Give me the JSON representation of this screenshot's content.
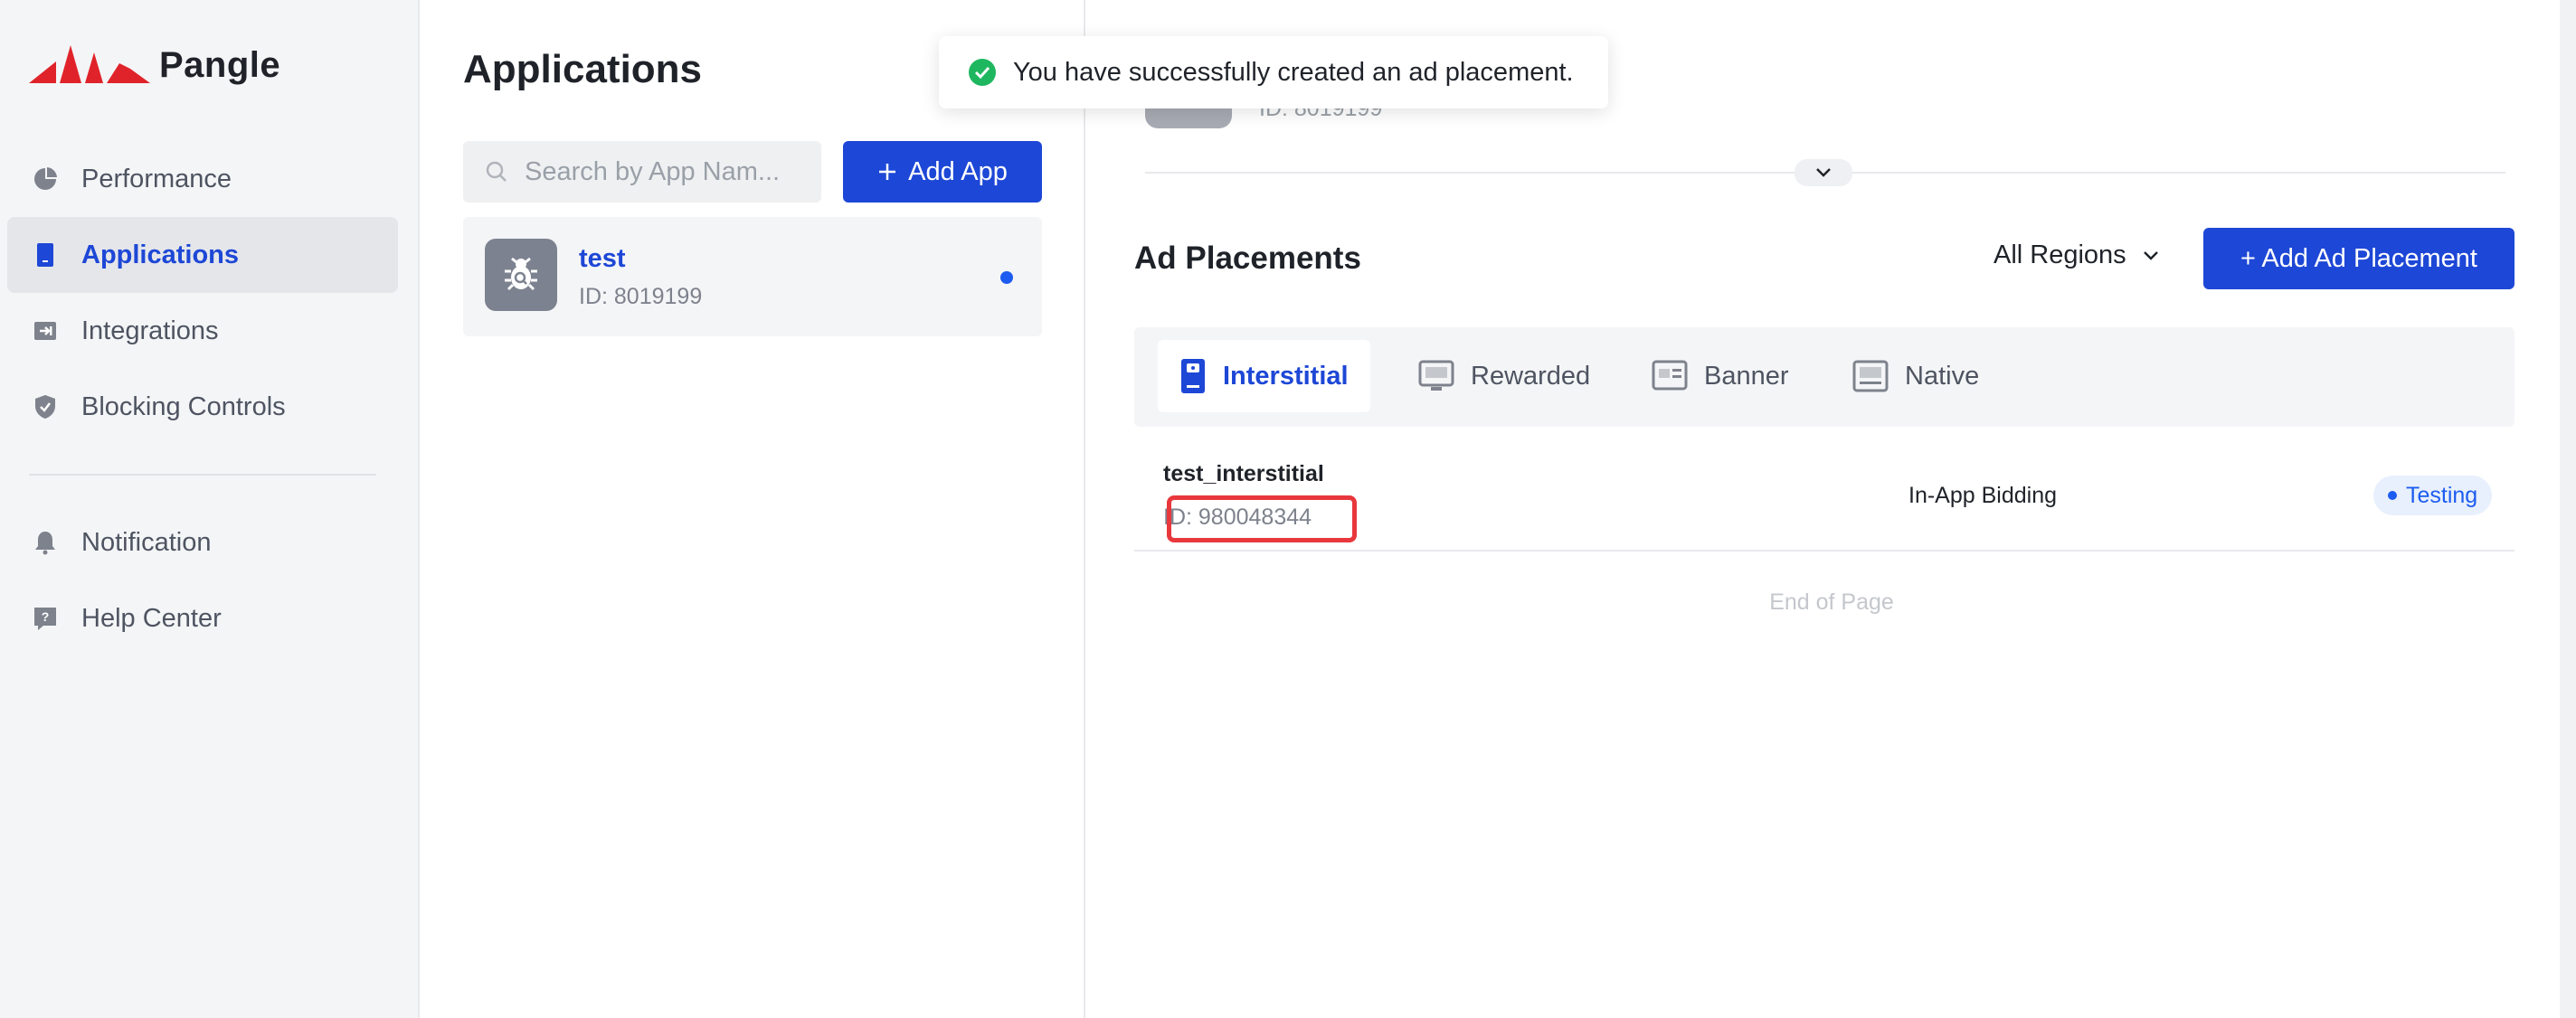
{
  "brand": {
    "name": "Pangle",
    "accent": "#1d47d6",
    "logo_color": "#e0232a"
  },
  "sidebar": {
    "items": [
      {
        "label": "Performance",
        "icon": "pie-chart-icon",
        "active": false
      },
      {
        "label": "Applications",
        "icon": "phone-icon",
        "active": true
      },
      {
        "label": "Integrations",
        "icon": "integration-icon",
        "active": false
      },
      {
        "label": "Blocking Controls",
        "icon": "shield-icon",
        "active": false
      }
    ],
    "bottom_items": [
      {
        "label": "Notification",
        "icon": "bell-icon"
      },
      {
        "label": "Help Center",
        "icon": "help-icon"
      }
    ]
  },
  "applications": {
    "title": "Applications",
    "search_placeholder": "Search by App Nam...",
    "add_app_label": "Add App",
    "apps": [
      {
        "name": "test",
        "id": "ID: 8019199",
        "icon": "bug-icon"
      }
    ]
  },
  "detail": {
    "partial_id": "ID: 8019199",
    "ad_placements_title": "Ad Placements",
    "region": "All Regions",
    "add_placement_label": "+ Add Ad Placement",
    "tabs": [
      {
        "label": "Interstitial",
        "icon": "interstitial-icon",
        "active": true
      },
      {
        "label": "Rewarded",
        "icon": "rewarded-icon",
        "active": false
      },
      {
        "label": "Banner",
        "icon": "banner-icon",
        "active": false
      },
      {
        "label": "Native",
        "icon": "native-icon",
        "active": false
      }
    ],
    "placements": [
      {
        "name": "test_interstitial",
        "id": "ID: 980048344",
        "bidding": "In-App Bidding",
        "status": "Testing"
      }
    ],
    "end_of_page": "End of Page"
  },
  "toast": {
    "message": "You have successfully created an ad placement.",
    "icon": "check-circle-icon"
  }
}
